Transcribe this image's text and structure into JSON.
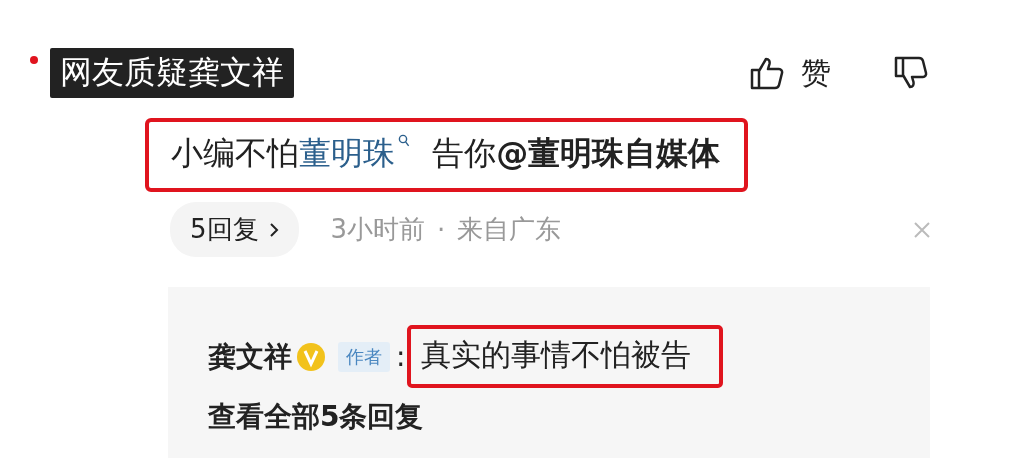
{
  "caption": {
    "text": "网友质疑龚文祥"
  },
  "actions": {
    "like_label": "赞"
  },
  "comment": {
    "highlighted": true,
    "segments": [
      {
        "kind": "text",
        "text": "小编不怕"
      },
      {
        "kind": "link",
        "text": "董明珠"
      },
      {
        "kind": "text",
        "text": " 告你"
      },
      {
        "kind": "mention",
        "text": "@董明珠自媒体"
      }
    ]
  },
  "meta": {
    "reply_count": "5回复",
    "time": "3小时前",
    "separator": "·",
    "location": "来自广东"
  },
  "reply": {
    "author": "龚文祥",
    "verified": true,
    "tag": "作者",
    "colon": ":",
    "text": "真实的事情不怕被告",
    "highlighted": true,
    "view_all": "查看全部5条回复"
  }
}
